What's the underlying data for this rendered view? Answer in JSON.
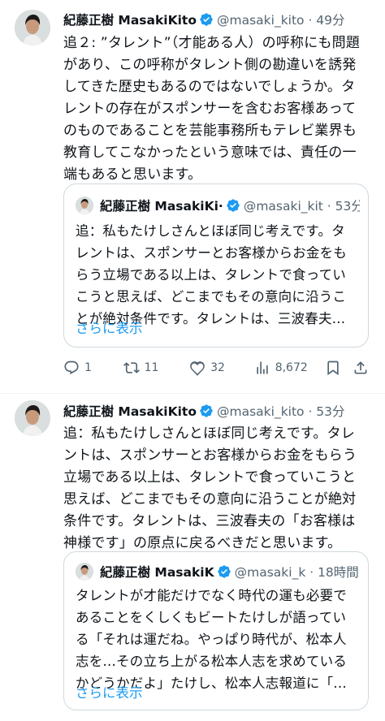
{
  "tweet1": {
    "name": "紀藤正樹 MasakiKito",
    "handle": "@masaki_kito · 49分",
    "text": "追２: ”タレント”（才能ある人）の呼称にも問題\nがあり、この呼称がタレント側の勘違いを誘発\nしてきた歴史もあるのではないでしょうか。タ\nレントの存在がスポンサーを含むお客様あって\nのものであることを芸能事務所もテレビ業界も\n教育してこなかったという意味では、責任の一\n端もあると思います。",
    "quote": {
      "name": "紀藤正樹 MasakiKi·",
      "handle": "@masaki_kit · 53分",
      "text": "追：私もたけしさんとほぼ同じ考えです。タ\nレントは、スポンサーとお客様からお金をも\nらう立場である以上は、タレントで食ってい\nこうと思えば、どこまでもその意向に沿うこ\nとが絶対条件です。タレントは、三波春夫…",
      "more": "さらに表示"
    },
    "actions": {
      "reply": "1",
      "retweet": "11",
      "like": "32",
      "views": "8,672"
    }
  },
  "tweet2": {
    "name": "紀藤正樹 MasakiKito",
    "handle": "@masaki_kito · 53分",
    "text": "追：私もたけしさんとほぼ同じ考えです。タレ\nントは、スポンサーとお客様からお金をもらう\n立場である以上は、タレントで食っていこうと\n思えば、どこまでもその意向に沿うことが絶対\n条件です。タレントは、三波春夫の「お客様は\n神様です」の原点に戻るべきだと思います。",
    "quote": {
      "name": "紀藤正樹 MasakiK",
      "handle": "@masaki_k · 18時間",
      "text": "タレントが才能だけでなく時代の運も必要で\nあることをくしくもビートたけしが語ってい\nる「それは運だね。やっぱり時代が、松本人\n志を…その立ち上がる松本人志を求めている\nかどうかだよ」たけし、松本人志報道に「…",
      "more": "さらに表示"
    }
  },
  "colors": {
    "verified": "#1d9bf0",
    "link": "#1d9bf0",
    "secondary": "#536471"
  }
}
